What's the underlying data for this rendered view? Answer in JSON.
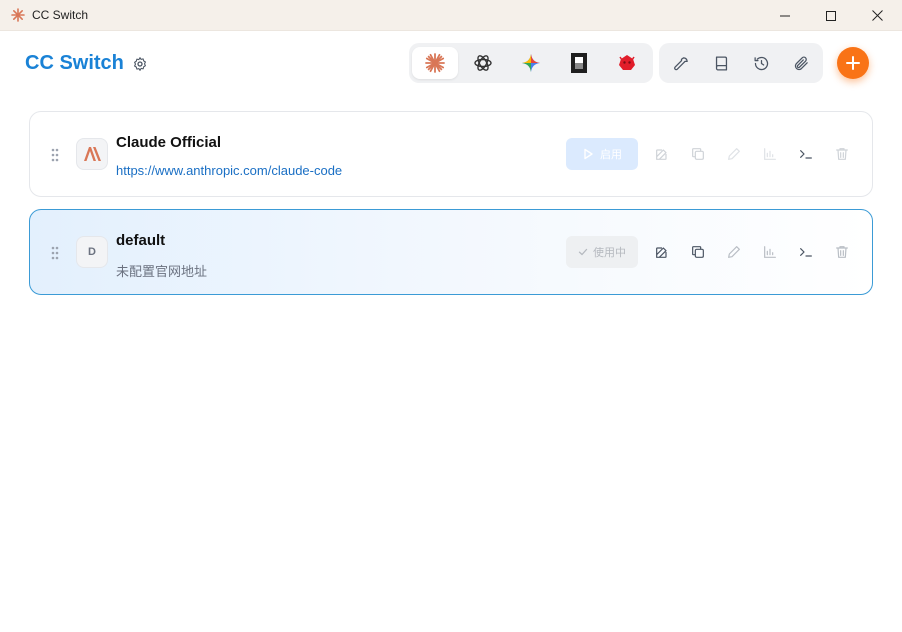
{
  "window": {
    "title": "CC Switch"
  },
  "header": {
    "brand": "CC Switch"
  },
  "app_tabs": [
    {
      "name": "claude",
      "active": true
    },
    {
      "name": "openai",
      "active": false
    },
    {
      "name": "gemini",
      "active": false
    },
    {
      "name": "opencode",
      "active": false
    },
    {
      "name": "other",
      "active": false
    }
  ],
  "colors": {
    "accent": "#1a82d6",
    "add": "#f97316",
    "claude": "#d97757"
  },
  "providers": [
    {
      "name": "Claude Official",
      "subtitle": "https://www.anthropic.com/claude-code",
      "avatar": "A\\",
      "button_label": "启用",
      "active": false
    },
    {
      "name": "default",
      "subtitle": "未配置官网地址",
      "avatar": "D",
      "button_label": "使用中",
      "active": true
    }
  ]
}
